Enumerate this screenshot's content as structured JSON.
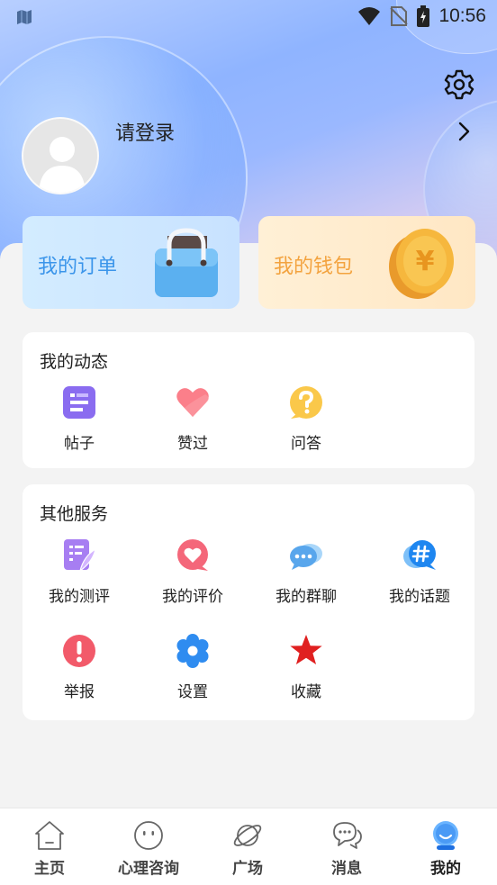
{
  "status_bar": {
    "time": "10:56"
  },
  "profile": {
    "login_text": "请登录"
  },
  "cards": {
    "orders_label": "我的订单",
    "wallet_label": "我的钱包",
    "coin_symbol": "¥"
  },
  "dynamics": {
    "title": "我的动态",
    "items": [
      {
        "label": "帖子",
        "icon": "post-icon"
      },
      {
        "label": "赞过",
        "icon": "heart-icon"
      },
      {
        "label": "问答",
        "icon": "question-icon"
      }
    ]
  },
  "services": {
    "title": "其他服务",
    "items": [
      {
        "label": "我的测评",
        "icon": "assessment-icon"
      },
      {
        "label": "我的评价",
        "icon": "review-icon"
      },
      {
        "label": "我的群聊",
        "icon": "group-chat-icon"
      },
      {
        "label": "我的话题",
        "icon": "topic-icon"
      },
      {
        "label": "举报",
        "icon": "report-icon"
      },
      {
        "label": "设置",
        "icon": "settings-flower-icon"
      },
      {
        "label": "收藏",
        "icon": "star-icon"
      }
    ]
  },
  "tabbar": {
    "items": [
      {
        "label": "主页",
        "icon": "home-icon"
      },
      {
        "label": "心理咨询",
        "icon": "counsel-icon"
      },
      {
        "label": "广场",
        "icon": "planet-icon"
      },
      {
        "label": "消息",
        "icon": "message-icon"
      },
      {
        "label": "我的",
        "icon": "me-icon"
      }
    ],
    "active_index": 4
  },
  "colors": {
    "orders_text": "#3b95ea",
    "wallet_text": "#f3a33f",
    "report_red": "#f25a6a",
    "settings_blue": "#2f8cf0",
    "star_red": "#e02020"
  }
}
